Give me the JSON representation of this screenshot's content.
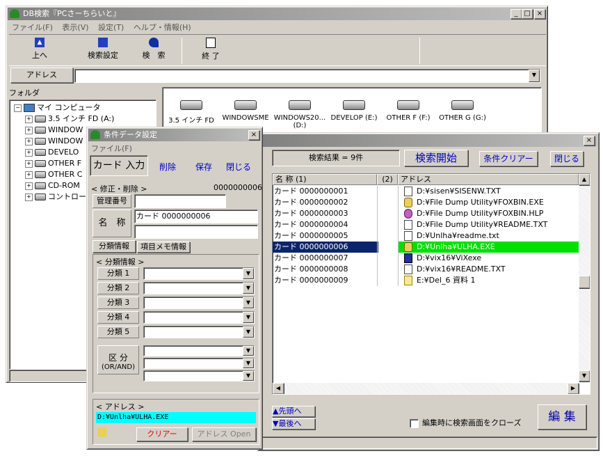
{
  "main_window": {
    "title": "DB検索『PCさーちらいと』",
    "menu": [
      "ファイル(F)",
      "表示(V)",
      "設定(T)",
      "ヘルプ・情報(H)"
    ],
    "toolbar": {
      "up": "上へ",
      "search_settings": "検索設定",
      "search": "検　索",
      "exit": "終 了"
    },
    "address_label": "アドレス",
    "address_value": "",
    "folder_label": "フォルダ",
    "tree": {
      "root": "マイ コンピュータ",
      "items": [
        "3.5 インチ FD (A:)",
        "WINDOW",
        "WINDOW",
        "DEVELO",
        "OTHER F",
        "OTHER C",
        "CD-ROM",
        "コントロー"
      ]
    },
    "drives": [
      "3.5 インチ FD",
      "WINDOWSME",
      "WINDOWS20...\n(D:)",
      "DEVELOP (E:)",
      "OTHER F (F:)",
      "OTHER G (G:)"
    ]
  },
  "results_window": {
    "result_count": "検索結果 = 9件",
    "start_search": "検索開始",
    "clear_conditions": "条件クリアー",
    "close": "閉じる",
    "columns": [
      "名 称 (1)",
      "(2)",
      "アドレス"
    ],
    "rows": [
      {
        "name": "カード 0000000001",
        "icon": "text-file-icon",
        "address": "D:¥sisen¥SISENW.TXT"
      },
      {
        "name": "カード 0000000002",
        "icon": "exe-icon",
        "address": "D:¥File Dump Utility¥FOXBIN.EXE"
      },
      {
        "name": "カード 0000000003",
        "icon": "help-file-icon",
        "address": "D:¥File Dump Utility¥FOXBIN.HLP"
      },
      {
        "name": "カード 0000000004",
        "icon": "text-file-icon",
        "address": "D:¥File Dump Utility¥README.TXT"
      },
      {
        "name": "カード 0000000005",
        "icon": "text-file-icon",
        "address": "D:¥Unlha¥readme.txt"
      },
      {
        "name": "カード 0000000006",
        "icon": "exe-icon",
        "address": "D:¥Unlha¥ULHA.EXE"
      },
      {
        "name": "カード 0000000007",
        "icon": "vix-icon",
        "address": "D:¥vix16¥ViXexe"
      },
      {
        "name": "カード 0000000008",
        "icon": "text-file-icon",
        "address": "D:¥vix16¥README.TXT"
      },
      {
        "name": "カード 0000000009",
        "icon": "folder-icon",
        "address": "E:¥Del_6 資料 1"
      }
    ],
    "selected_index": 5,
    "to_top": "▲先頭へ",
    "to_bottom": "▼最後へ",
    "close_on_edit": "編集時に検索画面をクローズ",
    "edit": "編 集"
  },
  "dialog": {
    "title": "条件データ設定",
    "menu": "ファイル(F)",
    "card_input": "カード 入力",
    "delete": "削除",
    "save": "保存",
    "close": "閉じる",
    "mode": "< 修正・削除 >",
    "mode_number": "0000000006",
    "mgmt_label": "管理番号",
    "mgmt_value": "",
    "name_label": "名　称",
    "name_value": "カード 0000000006",
    "name_value2": "",
    "tab1": "分類情報",
    "tab2": "項目メモ情報",
    "group": "< 分類情報 >",
    "classes": [
      "分類 1",
      "分類 2",
      "分類 3",
      "分類 4",
      "分類 5"
    ],
    "kubun": "区 分",
    "or_and": "(OR/AND)",
    "address_group": "< アドレス >",
    "address_value": "D:¥Unlha¥ULHA.EXE",
    "clear": "クリアー",
    "address_open": "アドレス Open"
  }
}
